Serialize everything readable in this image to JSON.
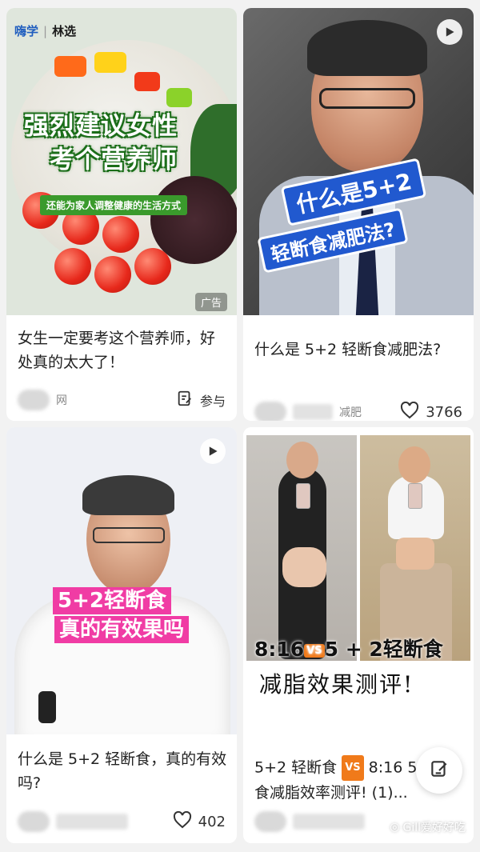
{
  "cards": [
    {
      "brand": {
        "left": "嗨学",
        "right": "林选"
      },
      "headline_line1": "强烈建议女性",
      "headline_line2": "考个营养师",
      "subheadline": "还能为家人调整健康的生活方式",
      "ad_badge": "广告",
      "caption": "女生一定要考这个营养师，好处真的太大了！",
      "author": "网",
      "action_label": "参与"
    },
    {
      "headline_line1": "什么是5+2",
      "headline_line2": "轻断食减肥法?",
      "caption": "什么是 5+2 轻断食减肥法?",
      "author": "减肥",
      "likes": "3766"
    },
    {
      "headline_line1": "5+2轻断食",
      "headline_line2": "真的有效果吗",
      "caption": "什么是 5+2 轻断食，真的有效吗?",
      "author": "",
      "likes": "402"
    },
    {
      "headline_part1": "8:16",
      "vs": "VS",
      "headline_part2": "5 + 2轻断食",
      "headline_line2": "减脂效果测评!",
      "caption_part1": "5+2 轻断食",
      "caption_vs": "VS",
      "caption_part2": "8:16 5",
      "caption_line2": "食减脂效率测评! (1)...",
      "author": ""
    }
  ],
  "watermark": "Gill爱好好吃",
  "icons": [
    "play-icon",
    "edit-icon",
    "heart-icon",
    "compose-icon"
  ],
  "colors": {
    "brand_blue": "#1f5dbf",
    "green_headline": "#1c6e1a",
    "blue_banner": "#2159cf",
    "pink_banner": "#f03ca4",
    "vs_orange": "#f07a1a"
  }
}
